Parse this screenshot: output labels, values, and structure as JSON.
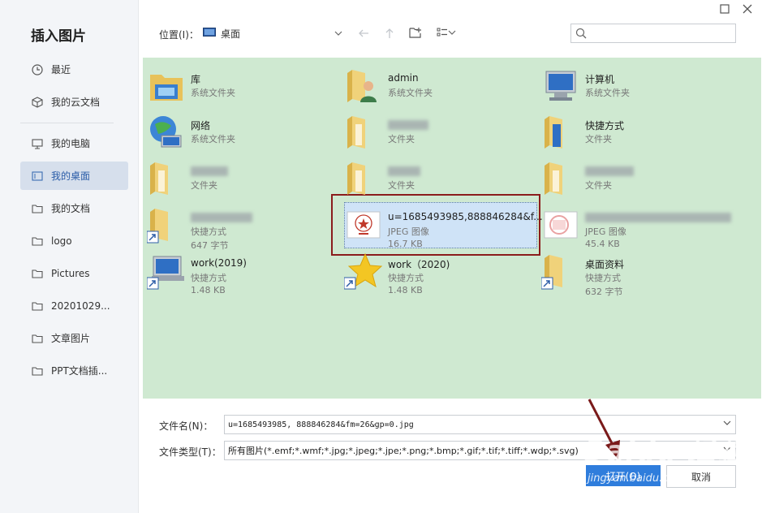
{
  "dialog": {
    "title": "插入图片"
  },
  "sidebar": {
    "items": [
      {
        "label": "最近",
        "icon": "clock-icon"
      },
      {
        "label": "我的云文档",
        "icon": "cube-icon"
      },
      {
        "label": "我的电脑",
        "icon": "monitor-icon"
      },
      {
        "label": "我的桌面",
        "icon": "desktop-icon"
      },
      {
        "label": "我的文档",
        "icon": "folder-icon"
      },
      {
        "label": "logo",
        "icon": "folder-icon"
      },
      {
        "label": "Pictures",
        "icon": "folder-icon"
      },
      {
        "label": "20201029...",
        "icon": "folder-icon"
      },
      {
        "label": "文章图片",
        "icon": "folder-icon"
      },
      {
        "label": "PPT文档插...",
        "icon": "folder-icon"
      }
    ],
    "active": "我的桌面"
  },
  "toolbar": {
    "location_label": "位置(I)：",
    "location_value": "桌面"
  },
  "files": [
    {
      "name": "库",
      "sub": "系统文件夹",
      "icon": "library-icon"
    },
    {
      "name": "admin",
      "sub": "系统文件夹",
      "icon": "user-folder-icon"
    },
    {
      "name": "计算机",
      "sub": "系统文件夹",
      "icon": "computer-icon"
    },
    {
      "name": "网络",
      "sub": "系统文件夹",
      "icon": "network-icon"
    },
    {
      "name": "",
      "sub": "文件夹",
      "icon": "folder-icon"
    },
    {
      "name": "快捷方式",
      "sub": "文件夹",
      "icon": "folder-icon"
    },
    {
      "name": "",
      "sub": "文件夹",
      "icon": "folder-icon"
    },
    {
      "name": "",
      "sub": "文件夹",
      "icon": "folder-icon"
    },
    {
      "name": "",
      "sub": "文件夹",
      "icon": "folder-icon"
    },
    {
      "name": "",
      "sub": "快捷方式",
      "sub2": "647 字节",
      "icon": "shortcut-icon"
    },
    {
      "name": "u=1685493985,888846284&f...",
      "sub": "JPEG 图像",
      "sub2": "16.7 KB",
      "icon": "image-thumb-icon"
    },
    {
      "name": "",
      "sub": "JPEG 图像",
      "sub2": "45.4 KB",
      "icon": "image-thumb-icon"
    },
    {
      "name": "work(2019)",
      "sub": "快捷方式",
      "sub2": "1.48 KB",
      "icon": "shortcut-icon"
    },
    {
      "name": "work（2020)",
      "sub": "快捷方式",
      "sub2": "1.48 KB",
      "icon": "star-icon"
    },
    {
      "name": "桌面资料",
      "sub": "快捷方式",
      "sub2": "632 字节",
      "icon": "folder-icon"
    }
  ],
  "bottom": {
    "filename_label": "文件名(N)：",
    "filename_value": "u=1685493985, 888846284&fm=26&gp=0.jpg",
    "filetype_label": "文件类型(T)：",
    "filetype_value": "所有图片(*.emf;*.wmf;*.jpg;*.jpeg;*.jpe;*.png;*.bmp;*.gif;*.tif;*.tiff;*.wdp;*.svg)",
    "open_label": "打开(O)",
    "cancel_label": "取消"
  },
  "watermark": {
    "text": "Baidu 经验",
    "sub": "jingyan.baidu.com"
  },
  "colors": {
    "file_area_bg": "#cfe9d1",
    "sidebar_bg": "#f3f5f8",
    "active_nav": "#d6dfec",
    "accent": "#2f7ddc",
    "frame": "#8b1c1c"
  }
}
